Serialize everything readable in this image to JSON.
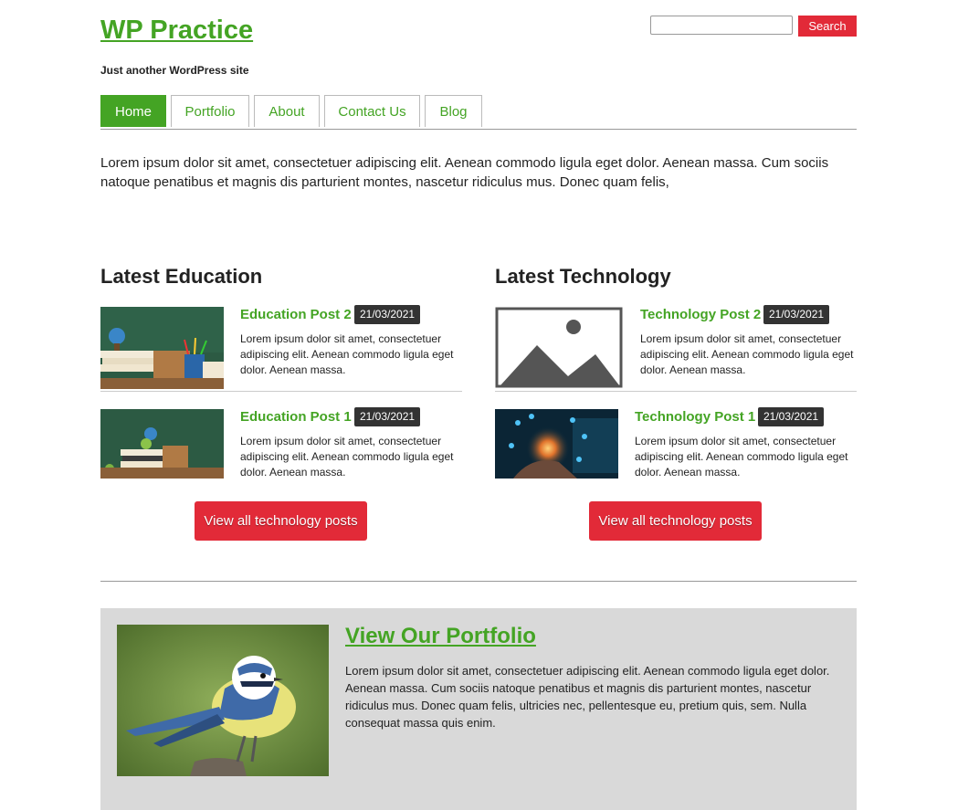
{
  "site": {
    "title": "WP Practice",
    "tagline": "Just another WordPress site",
    "search_placeholder": "",
    "search_button": "Search"
  },
  "nav": {
    "items": [
      {
        "label": "Home",
        "active": true
      },
      {
        "label": "Portfolio",
        "active": false
      },
      {
        "label": "About",
        "active": false
      },
      {
        "label": "Contact Us",
        "active": false
      },
      {
        "label": "Blog",
        "active": false
      }
    ]
  },
  "intro": "Lorem ipsum dolor sit amet, consectetuer adipiscing elit. Aenean commodo ligula eget dolor. Aenean massa. Cum sociis natoque penatibus et magnis dis parturient montes, nascetur ridiculus mus. Donec quam felis,",
  "education": {
    "heading": "Latest Education",
    "posts": [
      {
        "title": "Education Post 2",
        "date": "21/03/2021",
        "excerpt": "Lorem ipsum dolor sit amet, consectetuer adipiscing elit. Aenean commodo ligula eget dolor. Aenean massa."
      },
      {
        "title": "Education Post 1",
        "date": "21/03/2021",
        "excerpt": "Lorem ipsum dolor sit amet, consectetuer adipiscing elit. Aenean commodo ligula eget dolor. Aenean massa."
      }
    ],
    "button": "View all technology posts"
  },
  "technology": {
    "heading": "Latest Technology",
    "posts": [
      {
        "title": "Technology Post 2",
        "date": "21/03/2021",
        "excerpt": "Lorem ipsum dolor sit amet, consectetuer adipiscing elit. Aenean commodo ligula eget dolor. Aenean massa."
      },
      {
        "title": "Technology Post 1",
        "date": "21/03/2021",
        "excerpt": "Lorem ipsum dolor sit amet, consectetuer adipiscing elit. Aenean commodo ligula eget dolor. Aenean massa."
      }
    ],
    "button": "View all technology posts"
  },
  "portfolio": {
    "title": "View Our Portfolio",
    "text": "Lorem ipsum dolor sit amet, consectetuer adipiscing elit. Aenean commodo ligula eget dolor. Aenean massa. Cum sociis natoque penatibus et magnis dis parturient montes, nascetur ridiculus mus. Donec quam felis, ultricies nec, pellentesque eu, pretium quis, sem. Nulla consequat massa quis enim."
  },
  "colors": {
    "accent_green": "#44a424",
    "button_red": "#e22a38",
    "date_badge": "#333333",
    "portfolio_bg": "#d9d9d9"
  }
}
